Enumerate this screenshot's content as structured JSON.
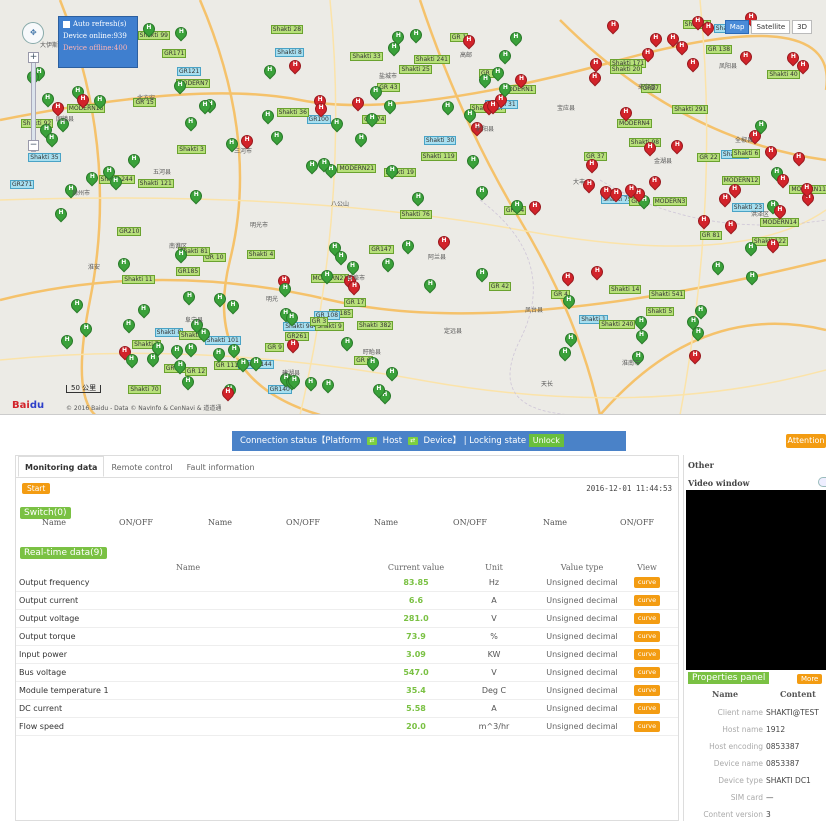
{
  "map": {
    "auto_refresh_label": "Auto refresh(s)",
    "device_online_text": "Device online:939",
    "device_offline_text": "Device offline:400",
    "map_type_buttons": [
      "Map",
      "Satellite",
      "3D"
    ],
    "scale_label": "50 公里",
    "baidu_logo_text": "Bai",
    "baidu_logo_mark": "du",
    "copyright_text": "© 2016 Baidu - Data © NavInfo & CenNavi & 道道通",
    "colors": {
      "online_pin": "#3aa13a",
      "offline_pin": "#d2232a",
      "label_bg": "#b7e07a",
      "land": "#ecebe6"
    },
    "tags": [
      "GR271",
      "GR171",
      "GR174",
      "GR147",
      "GR185",
      "Shakti 984",
      "MODERN4",
      "GR 22",
      "MODERN12",
      "Shakti 5",
      "GR140",
      "GR261",
      "MODERN1",
      "GR 138",
      "Shakti 121",
      "GR121",
      "GR 43",
      "MODERN21",
      "GR210",
      "GR185",
      "Shakti 75",
      "GR27",
      "GR 81",
      "Shakti 14",
      "GR 9",
      "GR 108",
      "Shakti 167",
      "Shakti 2",
      "MODERN15",
      "MODERN7",
      "GR100",
      "Shakti 119",
      "GR 10",
      "Shakti 9",
      "GR 37",
      "Shakti 5",
      "MODERN14",
      "Shakti 541",
      "GR 111",
      "GR 3",
      "Shakti 31",
      "Shakti 171",
      "Shakti 92",
      "Shakti 99",
      "Shakti 25",
      "Shakti 30",
      "Shakti 11",
      "GR 12",
      "GR 5",
      "MODERN11",
      "Shakti 23",
      "GR 4",
      "Shakti 7",
      "GR 17",
      "GR 2",
      "Shakti 41",
      "GR 15",
      "Shakti 3",
      "Shakti 36",
      "MODERN21",
      "Shakti 8",
      "GR 18",
      "GR 14",
      "Shakti 6",
      "MODERN3",
      "Shakti 1",
      "Shakti 70",
      "GR 6",
      "GR 1",
      "Shakti 20",
      "Shakti 35",
      "Shakti 28",
      "Shakti 19",
      "GR 42",
      "Shakti 81",
      "Shakti 101",
      "Shakti 98",
      "Shakti 291",
      "Shakti 122",
      "Shakti 240",
      "Shakti 144",
      "Shakti 382",
      "Shakti 241",
      "Shakti 40",
      "Shakti 244",
      "Shakti 8",
      "Shakti 33",
      "Shakti 76",
      "Shakti 2",
      "Shakti 4"
    ],
    "places": [
      "大伊斯兰",
      "北方安",
      "三河市",
      "八公山",
      "阿兰县",
      "凤台县",
      "淮南市",
      "凤阳县",
      "固镇县",
      "五河县",
      "明光市",
      "蚌埠市",
      "定远县",
      "天长",
      "来安县",
      "全椒县",
      "滁州市",
      "南谯区",
      "明光",
      "盱眙县",
      "高邮",
      "宝应县",
      "金湖县",
      "洪泽区",
      "淮安",
      "阜宁县",
      "建湖县",
      "盐城市",
      "射阳县",
      "大丰"
    ]
  },
  "status": {
    "connection_label": "Connection status【Platform",
    "host_label": "Host",
    "device_label": "Device】",
    "locking_label": "| Locking state",
    "unlock_label": "Unlock",
    "attention_label": "Attention"
  },
  "tabs": [
    "Monitoring data",
    "Remote control",
    "Fault information"
  ],
  "monitoring": {
    "start_label": "Start",
    "timestamp": "2016-12-01 11:44:53",
    "switch_label": "Switch(0)",
    "switch_headers": [
      "Name",
      "ON/OFF",
      "Name",
      "ON/OFF",
      "Name",
      "ON/OFF",
      "Name",
      "ON/OFF"
    ],
    "realtime_label": "Real-time data(9)",
    "realtime_headers": {
      "name": "Name",
      "current_value": "Current value",
      "unit": "Unit",
      "value_type": "Value type",
      "view": "View"
    },
    "rows": [
      {
        "name": "Output frequency",
        "value": "83.85",
        "unit": "Hz",
        "type": "Unsigned decimal",
        "view": "curve"
      },
      {
        "name": "Output current",
        "value": "6.6",
        "unit": "A",
        "type": "Unsigned decimal",
        "view": "curve"
      },
      {
        "name": "Output voltage",
        "value": "281.0",
        "unit": "V",
        "type": "Unsigned decimal",
        "view": "curve"
      },
      {
        "name": "Output torque",
        "value": "73.9",
        "unit": "%",
        "type": "Unsigned decimal",
        "view": "curve"
      },
      {
        "name": "Input power",
        "value": "3.09",
        "unit": "KW",
        "type": "Unsigned decimal",
        "view": "curve"
      },
      {
        "name": "Bus voltage",
        "value": "547.0",
        "unit": "V",
        "type": "Unsigned decimal",
        "view": "curve"
      },
      {
        "name": "Module temperature 1",
        "value": "35.4",
        "unit": "Deg C",
        "type": "Unsigned decimal",
        "view": "curve"
      },
      {
        "name": "DC current",
        "value": "5.58",
        "unit": "A",
        "type": "Unsigned decimal",
        "view": "curve"
      },
      {
        "name": "Flow speed",
        "value": "20.0",
        "unit": "m^3/hr",
        "type": "Unsigned decimal",
        "view": "curve"
      }
    ]
  },
  "right_panel": {
    "other_title": "Other",
    "video_title": "Video window",
    "properties_title": "Properties panel",
    "more_label": "More",
    "header_name": "Name",
    "header_content": "Content",
    "props": [
      {
        "key": "Client name",
        "value": "SHAKTI@TEST"
      },
      {
        "key": "Host name",
        "value": "1912"
      },
      {
        "key": "Host encoding",
        "value": "0853387"
      },
      {
        "key": "Device name",
        "value": "0853387"
      },
      {
        "key": "Device type",
        "value": "SHAKTI DC1"
      },
      {
        "key": "SIM card",
        "value": "—"
      },
      {
        "key": "Content version",
        "value": "3"
      }
    ]
  }
}
